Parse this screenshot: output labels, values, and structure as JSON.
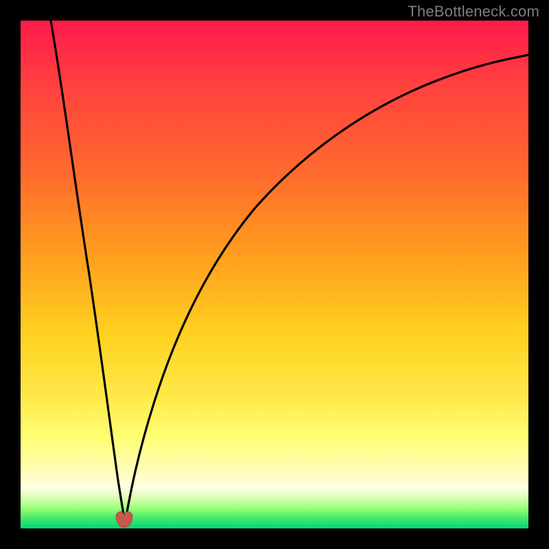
{
  "watermark": "TheBottleneck.com",
  "chart_data": {
    "type": "line",
    "title": "",
    "xlabel": "",
    "ylabel": "",
    "xlim": [
      0,
      1
    ],
    "ylim": [
      0,
      1
    ],
    "note": "Axes unlabeled; values normalized 0–1. Background gradient: red (top, y≈1) → green (bottom, y≈0). Notched minimum marked by small red lobed marker.",
    "series": [
      {
        "name": "bottleneck-curve-left",
        "x": [
          0.06,
          0.09,
          0.12,
          0.15,
          0.175,
          0.195,
          0.205
        ],
        "y": [
          1.0,
          0.805,
          0.595,
          0.365,
          0.175,
          0.05,
          0.01
        ]
      },
      {
        "name": "bottleneck-curve-right",
        "x": [
          0.205,
          0.225,
          0.26,
          0.3,
          0.36,
          0.43,
          0.52,
          0.63,
          0.76,
          0.88,
          1.0
        ],
        "y": [
          0.01,
          0.075,
          0.225,
          0.37,
          0.525,
          0.645,
          0.745,
          0.82,
          0.878,
          0.91,
          0.932
        ]
      }
    ],
    "marker": {
      "name": "minimum-marker",
      "x": 0.205,
      "y": 0.01,
      "shape": "double-lobe",
      "color": "#c95a4a"
    },
    "gradient_stops": [
      {
        "y": 1.0,
        "color": "#ff1a4b"
      },
      {
        "y": 0.55,
        "color": "#ff9a1f"
      },
      {
        "y": 0.3,
        "color": "#ffe84a"
      },
      {
        "y": 0.1,
        "color": "#ffffe4"
      },
      {
        "y": 0.0,
        "color": "#00d77a"
      }
    ]
  }
}
